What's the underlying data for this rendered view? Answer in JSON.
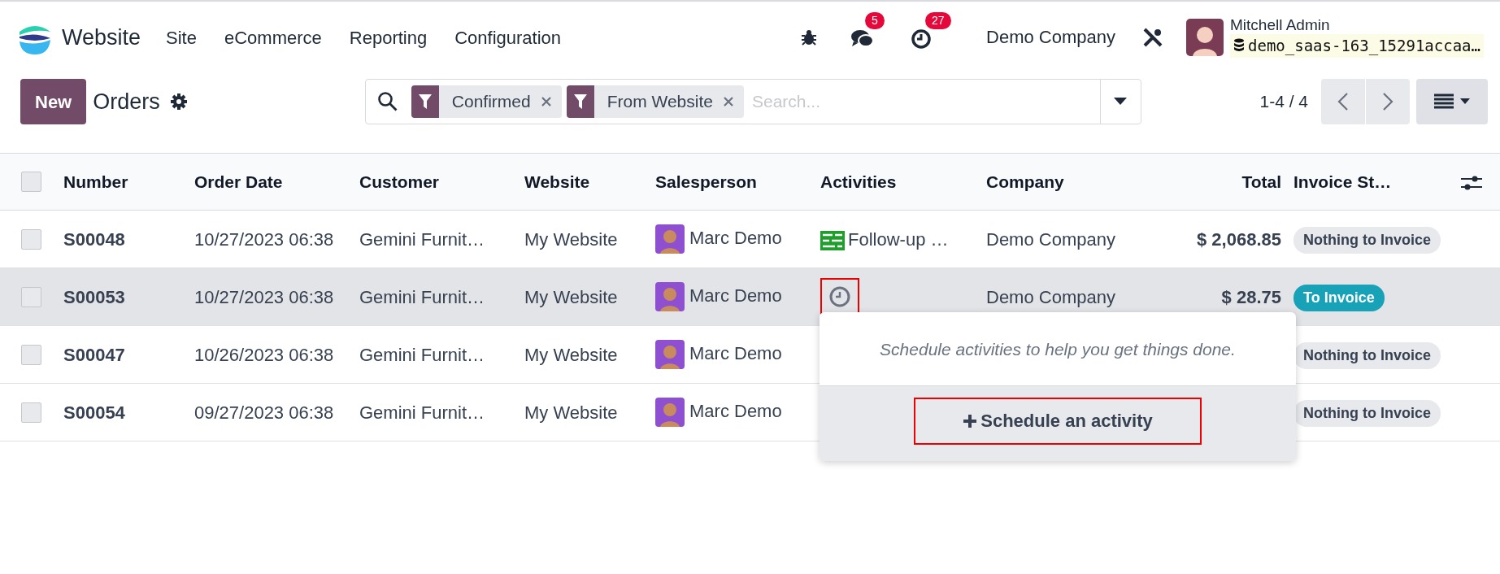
{
  "app": {
    "name": "Website"
  },
  "menu": [
    {
      "label": "Site"
    },
    {
      "label": "eCommerce"
    },
    {
      "label": "Reporting"
    },
    {
      "label": "Configuration"
    }
  ],
  "systray": {
    "messages_count": "5",
    "activities_count": "27",
    "company": "Demo Company",
    "user": "Mitchell Admin",
    "database": "demo_saas-163_15291accaa…"
  },
  "control_panel": {
    "new_button": "New",
    "title": "Orders",
    "facets": [
      {
        "label": "Confirmed"
      },
      {
        "label": "From Website"
      }
    ],
    "search_placeholder": "Search...",
    "pager": "1-4 / 4"
  },
  "table": {
    "all_checked": false,
    "columns": [
      "Number",
      "Order Date",
      "Customer",
      "Website",
      "Salesperson",
      "Activities",
      "Company",
      "Total",
      "Invoice St…"
    ],
    "rows": [
      {
        "number": "S00048",
        "order_date": "10/27/2023 06:38",
        "customer": "Gemini Furnit…",
        "website": "My Website",
        "salesperson": "Marc Demo",
        "activity": {
          "kind": "summary",
          "label": "Follow-up …"
        },
        "company": "Demo Company",
        "total": "$ 2,068.85",
        "invoice_status": {
          "kind": "nothing",
          "label": "Nothing to Invoice"
        },
        "hovered": false,
        "checked": false
      },
      {
        "number": "S00053",
        "order_date": "10/27/2023 06:38",
        "customer": "Gemini Furnit…",
        "website": "My Website",
        "salesperson": "Marc Demo",
        "activity": {
          "kind": "empty",
          "highlighted": true
        },
        "company": "Demo Company",
        "total": "$ 28.75",
        "invoice_status": {
          "kind": "to_invoice",
          "label": "To Invoice"
        },
        "hovered": true,
        "checked": false
      },
      {
        "number": "S00047",
        "order_date": "10/26/2023 06:38",
        "customer": "Gemini Furnit…",
        "website": "My Website",
        "salesperson": "Marc Demo",
        "activity": {
          "kind": "hidden"
        },
        "invoice_status": {
          "kind": "nothing",
          "label": "Nothing to Invoice"
        },
        "hovered": false,
        "checked": false
      },
      {
        "number": "S00054",
        "order_date": "09/27/2023 06:38",
        "customer": "Gemini Furnit…",
        "website": "My Website",
        "salesperson": "Marc Demo",
        "activity": {
          "kind": "hidden"
        },
        "invoice_status": {
          "kind": "nothing",
          "label": "Nothing to Invoice"
        },
        "hovered": false,
        "checked": false
      }
    ]
  },
  "popover": {
    "message": "Schedule activities to help you get things done.",
    "button": "Schedule an activity",
    "button_highlighted": true
  }
}
